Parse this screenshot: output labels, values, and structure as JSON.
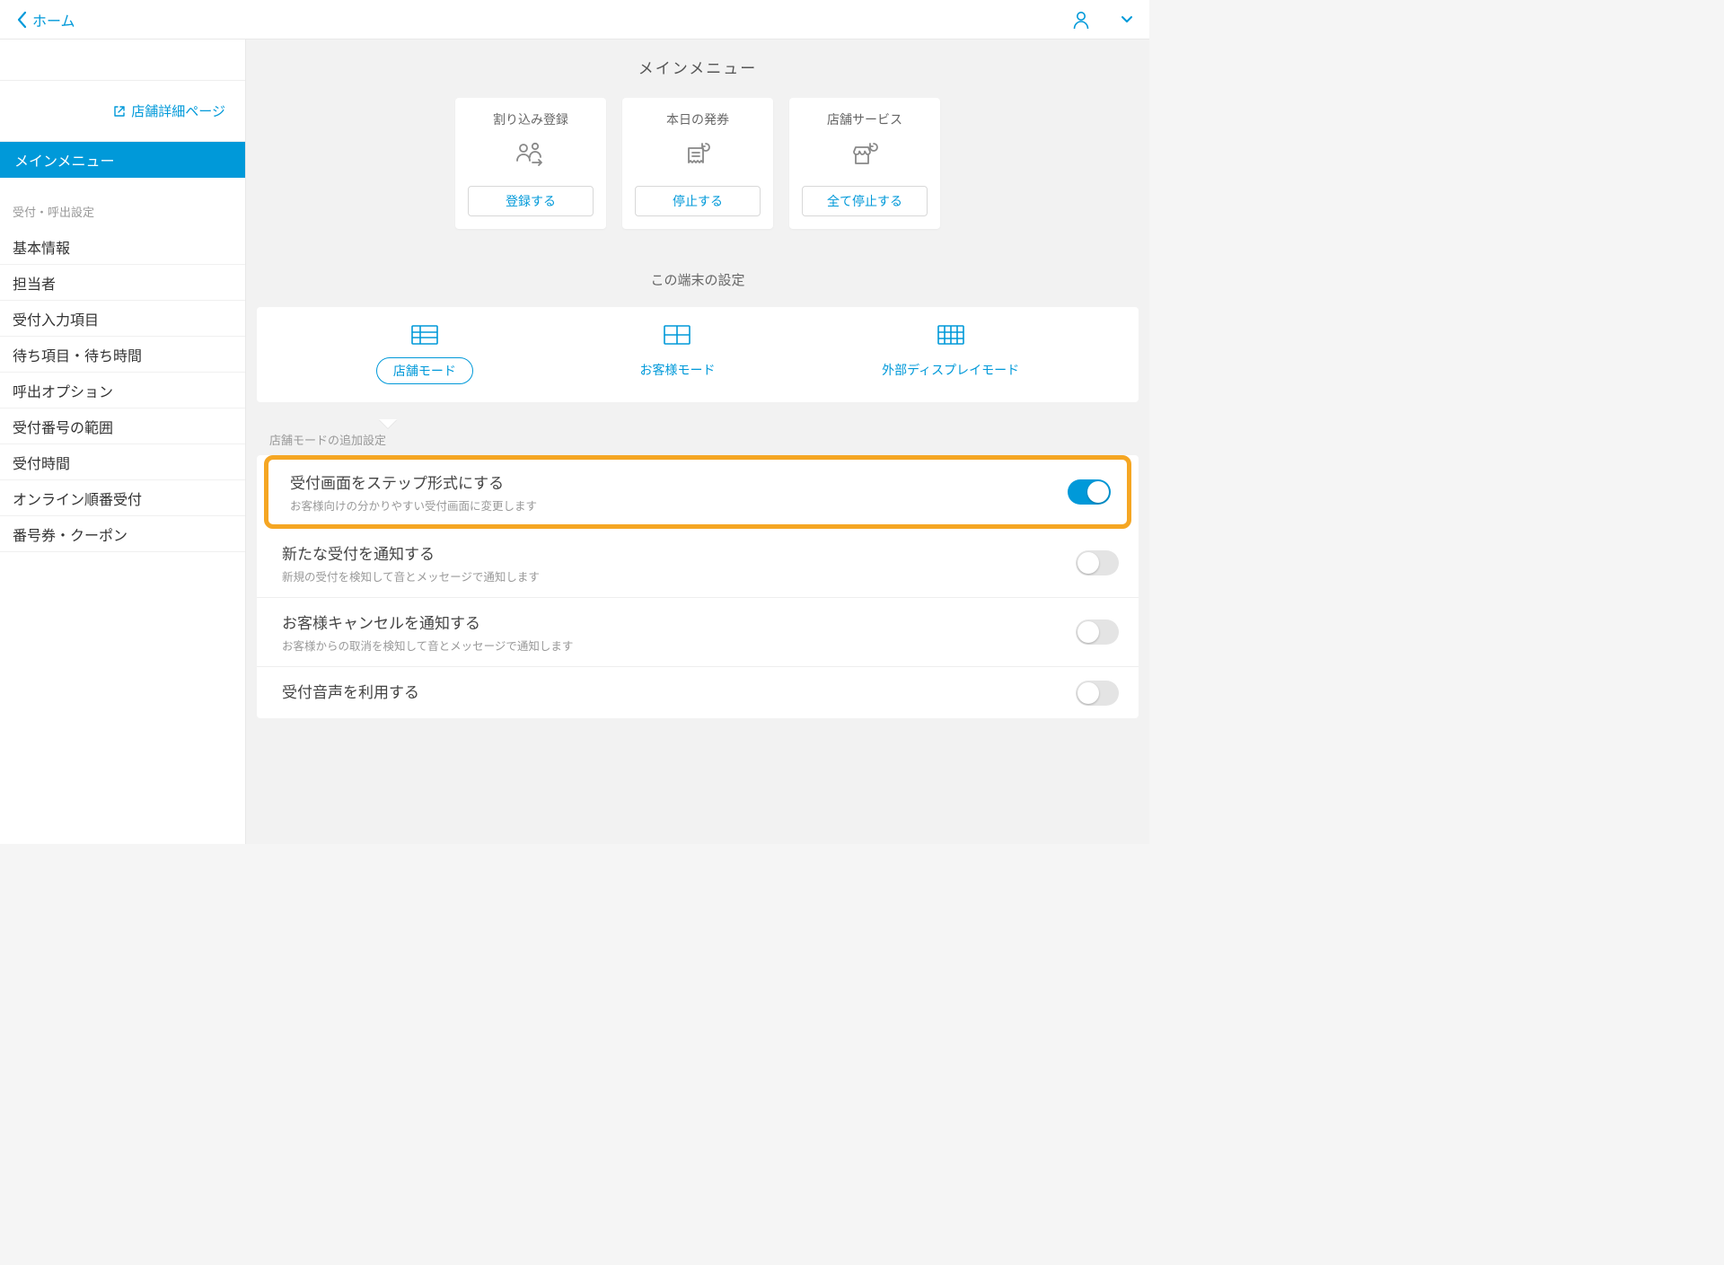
{
  "topbar": {
    "back_label": "ホーム"
  },
  "sidebar": {
    "store_link": "店舗詳細ページ",
    "nav_main": "メインメニュー",
    "section_label": "受付・呼出設定",
    "items": [
      "基本情報",
      "担当者",
      "受付入力項目",
      "待ち項目・待ち時間",
      "呼出オプション",
      "受付番号の範囲",
      "受付時間",
      "オンライン順番受付",
      "番号券・クーポン"
    ]
  },
  "main": {
    "title": "メインメニュー",
    "cards": [
      {
        "title": "割り込み登録",
        "button": "登録する"
      },
      {
        "title": "本日の発券",
        "button": "停止する"
      },
      {
        "title": "店舗サービス",
        "button": "全て停止する"
      }
    ],
    "device_title": "この端末の設定",
    "tabs": [
      {
        "label": "店舗モード"
      },
      {
        "label": "お客様モード"
      },
      {
        "label": "外部ディスプレイモード"
      }
    ],
    "settings_caption": "店舗モードの追加設定",
    "settings": [
      {
        "title": "受付画面をステップ形式にする",
        "desc": "お客様向けの分かりやすい受付画面に変更します",
        "on": true,
        "highlight": true
      },
      {
        "title": "新たな受付を通知する",
        "desc": "新規の受付を検知して音とメッセージで通知します",
        "on": false
      },
      {
        "title": "お客様キャンセルを通知する",
        "desc": "お客様からの取消を検知して音とメッセージで通知します",
        "on": false
      },
      {
        "title": "受付音声を利用する",
        "desc": "",
        "on": false
      }
    ]
  }
}
